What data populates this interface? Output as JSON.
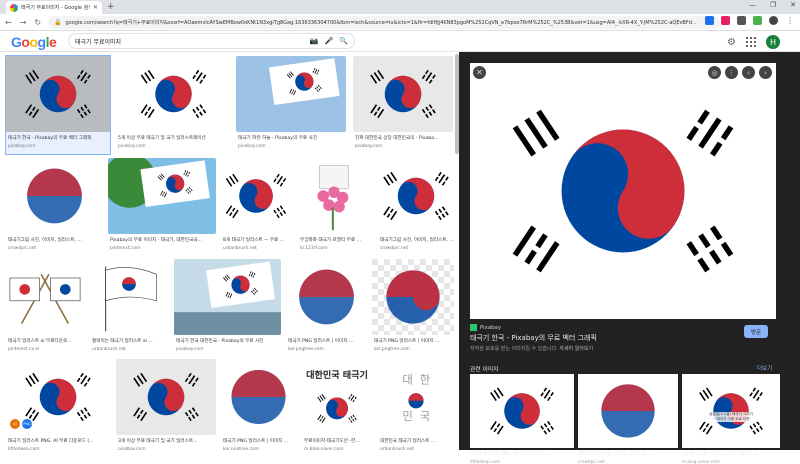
{
  "browser": {
    "tab_title": "태극기 무료이미지 - Google 검색",
    "url": "google.com/search?q=태극기+무료이미지&sxsrf=AOaemvIcAYSwEMBow0oKNt1N3xgiTg8Gag:1636336304700&tbm=isch&source=iu&ictx=1&fir=fdlHJj4KN83pgoM%252CqVN_e7bpxe7RrM%252C_%253B&vet=1&usg=AI4_-kXR-4X_Y-jM%252C-aQEvBFd..."
  },
  "google": {
    "logo": "Google",
    "search_value": "태극기 무료이미지",
    "avatar_letter": "H"
  },
  "results": [
    {
      "caption": "태극기 한국 - Pixabay의 무료 벡터 그래픽",
      "site": "pixabay.com",
      "style": "gray-wave"
    },
    {
      "caption": "5개 이상 무료 태극기 및 국기 일러스트레이션",
      "site": "pixabay.com",
      "style": "wave"
    },
    {
      "caption": "태극기 파란 하늘 - Pixabay의 무료 사진",
      "site": "pixabay.com",
      "style": "sky"
    },
    {
      "caption": "진짜 대한민국 상징 대한민국의 - Pixaba...",
      "site": "pixabay.com",
      "style": "silk"
    },
    {
      "caption": "태극기그림 사진, 이미지, 일러스트, ...",
      "site": "crowdpic.net",
      "style": "watercolor"
    },
    {
      "caption": "Pixabay의 무료 이미지 - 태극기, 대한민국국...",
      "site": "pinterest.com",
      "style": "tree"
    },
    {
      "caption": "8개 태극기 일러스트 ㅡ 무료 ...",
      "site": "urbanbrush.net",
      "style": "flag"
    },
    {
      "caption": "무궁화와 태극기 로열티 무료 ...",
      "site": "kr.123rf.com",
      "style": "flowers"
    },
    {
      "caption": "태극기그림 사진, 이미지, 일러스트, ...",
      "site": "crowdpic.net",
      "style": "flag"
    },
    {
      "caption": "태극기 일러스트 ai 무료다운로...",
      "site": "pinterest.co.kr",
      "style": "crossed"
    },
    {
      "caption": "펄럭이는 태극기 일러스트 ai ...",
      "site": "urbanbrush.net",
      "style": "pole"
    },
    {
      "caption": "태극기 한국 대한민국 - Pixabay의 무료 사진",
      "site": "pixabay.com",
      "style": "bay"
    },
    {
      "caption": "태극기 PNG 일러스트 | 이미지 ...",
      "site": "kor.pngtree.com",
      "style": "splash"
    },
    {
      "caption": "태극기 PNG 일러스트 | 이미지 ...",
      "site": "kor.pngtree.com",
      "style": "checker"
    },
    {
      "caption": "태극기 일러스트 PNG, AI 무료 다운로드 (...",
      "site": "littledeep.com",
      "style": "flag"
    },
    {
      "caption": "3개 이상 무료 태극기 및 국기 일러스트...",
      "site": "pixabay.com",
      "style": "silk"
    },
    {
      "caption": "태극기 PNG 일러스트 | 이미지 ...",
      "site": "kor.pngtree.com",
      "style": "splash"
    },
    {
      "caption": "무료이미지-태극기도안 -한...",
      "site": "m.blog.naver.com",
      "style": "text"
    },
    {
      "caption": "대한민국 태극기 일러스트 ...",
      "site": "urbanbrush.net",
      "style": "text2"
    }
  ],
  "result_badges": {
    "ai": "AI",
    "png": "PNG"
  },
  "thumb_texts": {
    "korea_title": "대한민국 태극기",
    "korea_chars": [
      "대",
      "한",
      "민",
      "국"
    ]
  },
  "panel": {
    "source": "Pixabay",
    "title": "태극기 한국 - Pixabay의 무료 벡터 그래픽",
    "copyright": "저작권 보호를 받는 이미지일 수 있습니다.",
    "learn_more": "자세히 알아보기",
    "visit_label": "방문",
    "related_label": "관련 이미지",
    "more_label": "더보기",
    "related": [
      {
        "caption": "태극기 일러스트 PNG, AI 무료 다운로드 (...",
        "site": "littledeep.com"
      },
      {
        "caption": "광복절태극기 사진, 이미지, 일러스트, ...",
        "site": "crowdpic.net"
      },
      {
        "caption": "삼일절(3.1절) 태극기 그리기 - 태극기 그...",
        "site": "m.blog.naver.com"
      }
    ],
    "related_inner_text": "삼일절(3.1절) 태극기 그리기\n~ 태극기 그림 무료 다운"
  },
  "colors": {
    "red": "#cd2e3a",
    "blue": "#0047a0",
    "black": "#000000"
  }
}
